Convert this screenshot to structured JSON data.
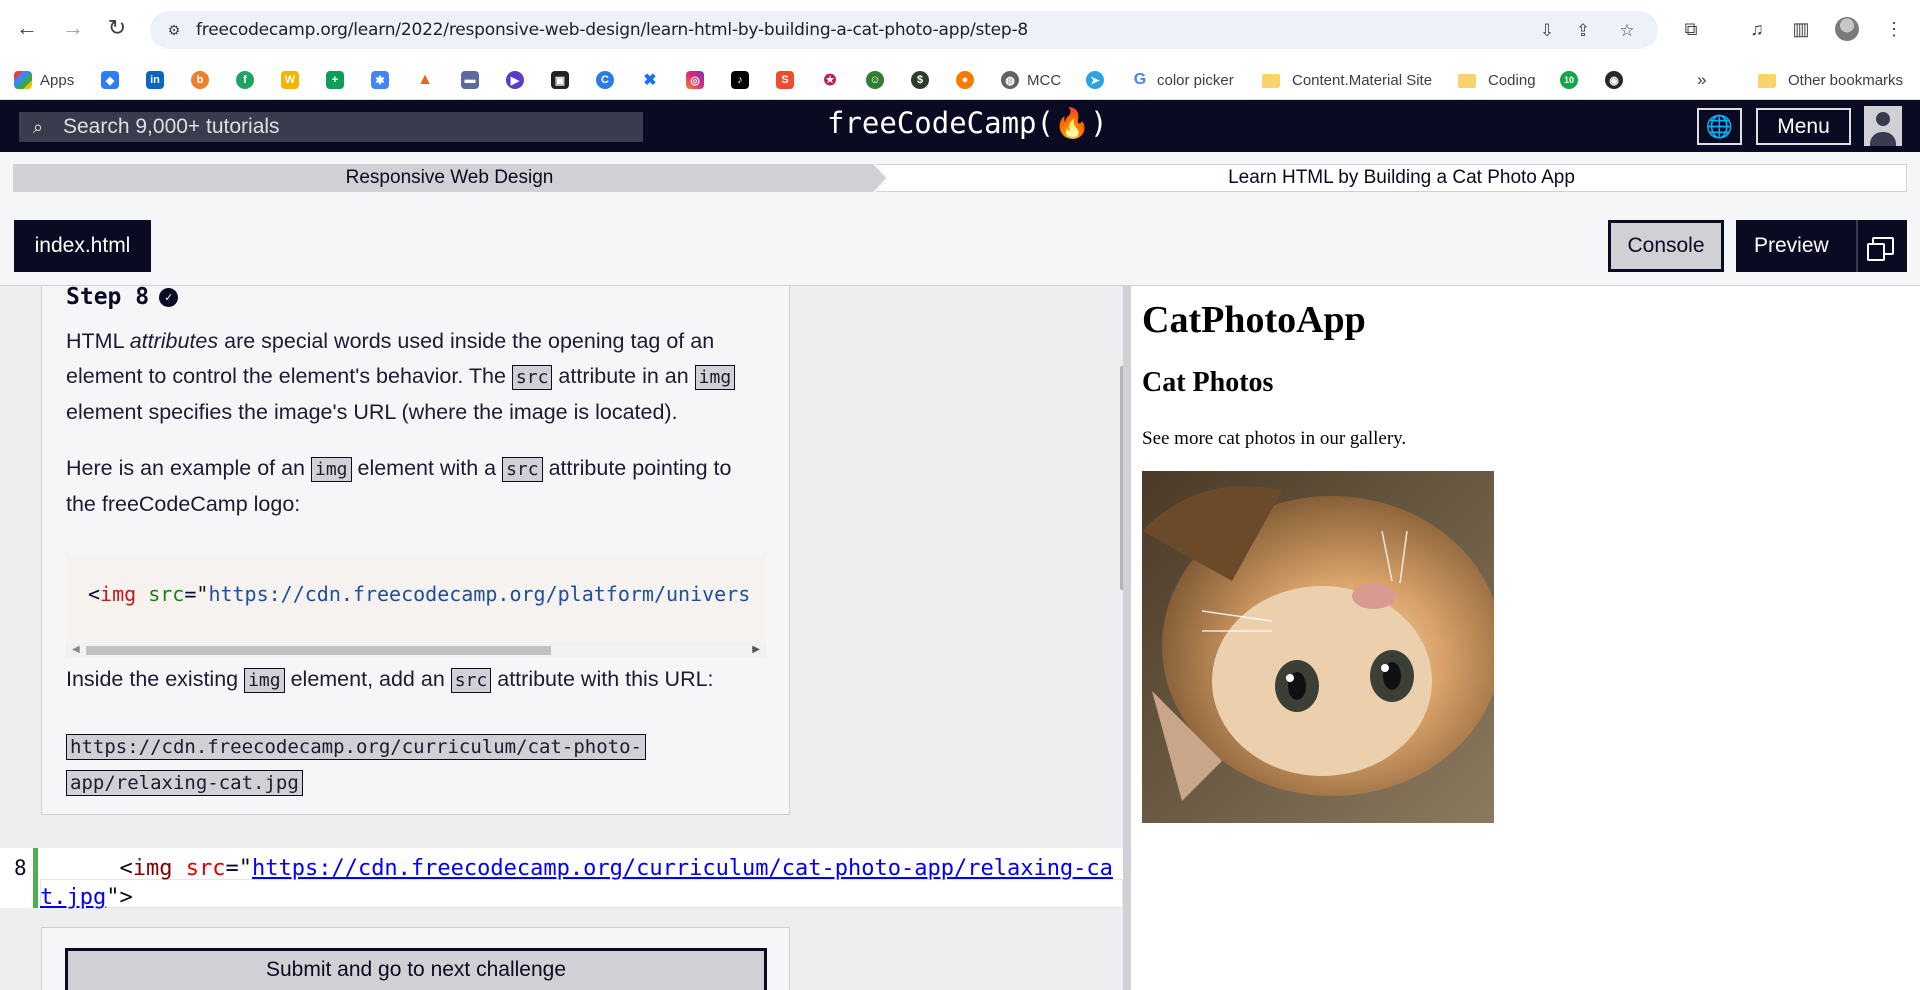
{
  "browser": {
    "url": "freecodecamp.org/learn/2022/responsive-web-design/learn-html-by-building-a-cat-photo-app/step-8",
    "bookmarks": {
      "apps": "Apps",
      "mcc": "MCC",
      "color_picker": "color picker",
      "content_material": "Content.Material Site",
      "coding": "Coding",
      "more": "»",
      "other": "Other bookmarks"
    }
  },
  "fcc_nav": {
    "search_placeholder": "Search 9,000+ tutorials",
    "logo": "freeCodeCamp(🔥)",
    "menu": "Menu"
  },
  "breadcrumb": {
    "superblock": "Responsive Web Design",
    "block": "Learn HTML by Building a Cat Photo App"
  },
  "editor_tabs": {
    "file": "index.html",
    "console": "Console",
    "preview": "Preview"
  },
  "description": {
    "step_title": "Step 8",
    "p1": {
      "a": "HTML ",
      "b": "attributes",
      "c": " are special words used inside the opening tag of an element to control the element's behavior. The ",
      "code1": "src",
      "d": " attribute in an ",
      "code2": "img",
      "e": " element specifies the image's URL (where the image is located)."
    },
    "p2": {
      "a": "Here is an example of an ",
      "code1": "img",
      "b": " element with a ",
      "code2": "src",
      "c": " attribute pointing to the freeCodeCamp logo:"
    },
    "example": {
      "lt": "<",
      "tag": "img",
      "attr": "src",
      "eq": "=\"",
      "value": "https://cdn.freecodecamp.org/platform/univers"
    },
    "p3": {
      "a": "Inside the existing ",
      "code1": "img",
      "b": " element, add an ",
      "code2": "src",
      "c": " attribute with this URL:"
    },
    "url": "https://cdn.freecodecamp.org/curriculum/cat-photo-app/relaxing-cat.jpg"
  },
  "editor": {
    "line_number": "8",
    "indent": "      ",
    "lt": "<",
    "tag": "img",
    "attr": "src",
    "eq": "=\"",
    "value": "https://cdn.freecodecamp.org/curriculum/cat-photo-app/relaxing-cat.jpg",
    "close": "\">"
  },
  "submit_label": "Submit and go to next challenge",
  "preview": {
    "h1": "CatPhotoApp",
    "h2": "Cat Photos",
    "p": "See more cat photos in our gallery."
  }
}
